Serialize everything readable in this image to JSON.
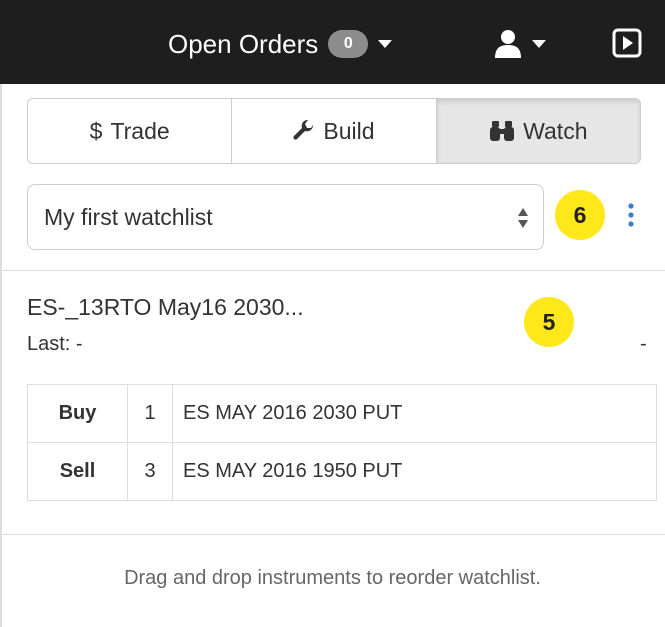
{
  "header": {
    "open_orders_label": "Open Orders",
    "open_orders_count": "0",
    "user_icon": "user-icon",
    "play_icon": "play-square-icon"
  },
  "tabs": [
    {
      "label": "Trade",
      "icon": "dollar-icon",
      "active": false
    },
    {
      "label": "Build",
      "icon": "wrench-icon",
      "active": false
    },
    {
      "label": "Watch",
      "icon": "binoculars-icon",
      "active": true
    }
  ],
  "watchlist": {
    "selected": "My first watchlist",
    "menu_icon": "vertical-ellipsis-icon"
  },
  "callouts": {
    "a": "6",
    "b": "5"
  },
  "instrument": {
    "title": "ES-_13RTO May16 2030...",
    "last_label": "Last: -",
    "last_value": "-",
    "legs": [
      {
        "action": "Buy",
        "qty": "1",
        "description": "ES MAY 2016 2030 PUT"
      },
      {
        "action": "Sell",
        "qty": "3",
        "description": "ES MAY 2016 1950 PUT"
      }
    ]
  },
  "footer": {
    "hint": "Drag and drop instruments to reorder watchlist."
  },
  "colors": {
    "topbar": "#1e1e1e",
    "badge_gray": "#8c8c8c",
    "callout_yellow": "#ffe81a",
    "accent_blue": "#3a7bd5"
  }
}
